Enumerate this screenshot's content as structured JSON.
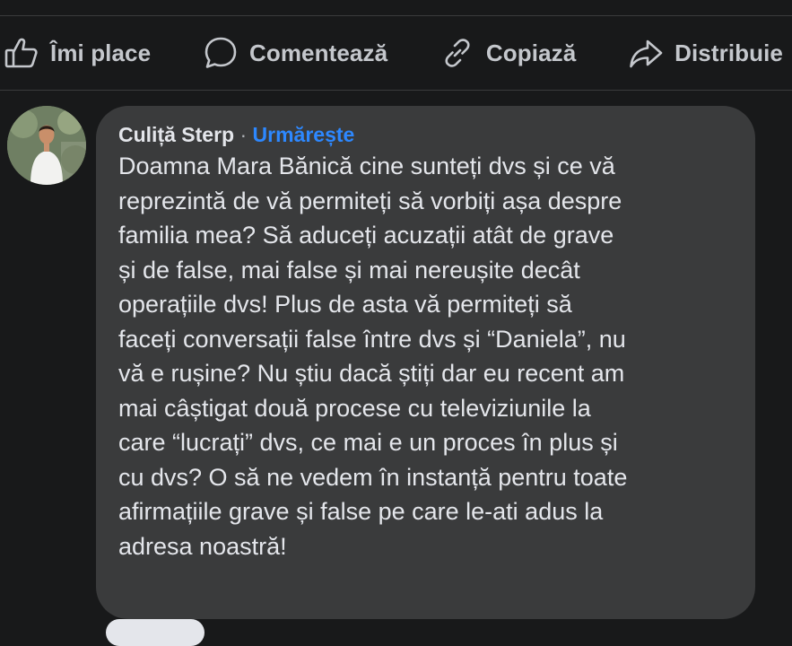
{
  "actions": {
    "like": "Îmi place",
    "comment": "Comentează",
    "copy": "Copiază",
    "share": "Distribuie"
  },
  "comment": {
    "author": "Culiță Sterp",
    "separator": "·",
    "follow": "Urmărește",
    "text": "Doamna Mara Bănică cine sunteți dvs și ce vă\nreprezintă de vă permiteți să vorbiți așa despre\nfamilia mea? Să aduceți acuzații atât de grave\nși de false, mai false și mai nereușite decât\noperațiile dvs! Plus de asta vă permiteți să\nfaceți conversații false între dvs și “Daniela”, nu\nvă e rușine? Nu știu dacă știți dar eu recent am\nmai câștigat două procese cu televiziunile la\ncare “lucrați” dvs, ce mai e un proces în plus și\ncu dvs? O să ne vedem în instanță pentru toate\nafirmațiile grave și false pe care le-ati adus la\nadresa noastră!"
  },
  "colors": {
    "background": "#18191a",
    "bubble": "#3a3b3c",
    "text": "#e4e6eb",
    "action_text": "#c4c7cc",
    "link": "#2d88ff"
  },
  "icons": [
    "thumbs-up-icon",
    "speech-bubble-icon",
    "link-icon",
    "share-arrow-icon"
  ]
}
